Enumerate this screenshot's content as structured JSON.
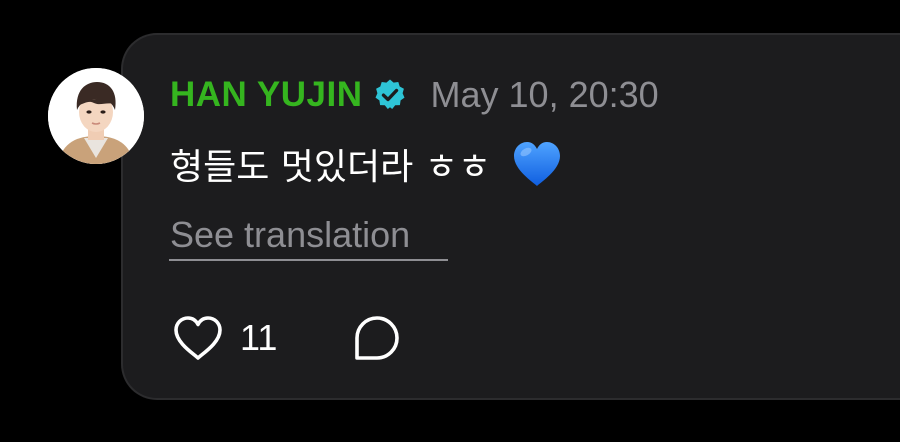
{
  "comment": {
    "author": "HAN YUJIN",
    "verified_icon": "verified-badge-icon",
    "timestamp": "May 10, 20:30",
    "text": "형들도 멋있더라 ㅎㅎ",
    "emoji": "blue-heart-emoji",
    "translate_label": "See translation",
    "like_count": "11",
    "like_icon": "heart-outline-icon",
    "reply_icon": "reply-bubble-icon"
  },
  "colors": {
    "background": "#000000",
    "card": "#1c1c1e",
    "card_border": "#2c2c2e",
    "author_name": "#35b51f",
    "verified_badge": "#2ec4d6",
    "muted_text": "#8e8e93",
    "primary_text": "#ffffff",
    "blue_heart": "#1a73f0"
  }
}
